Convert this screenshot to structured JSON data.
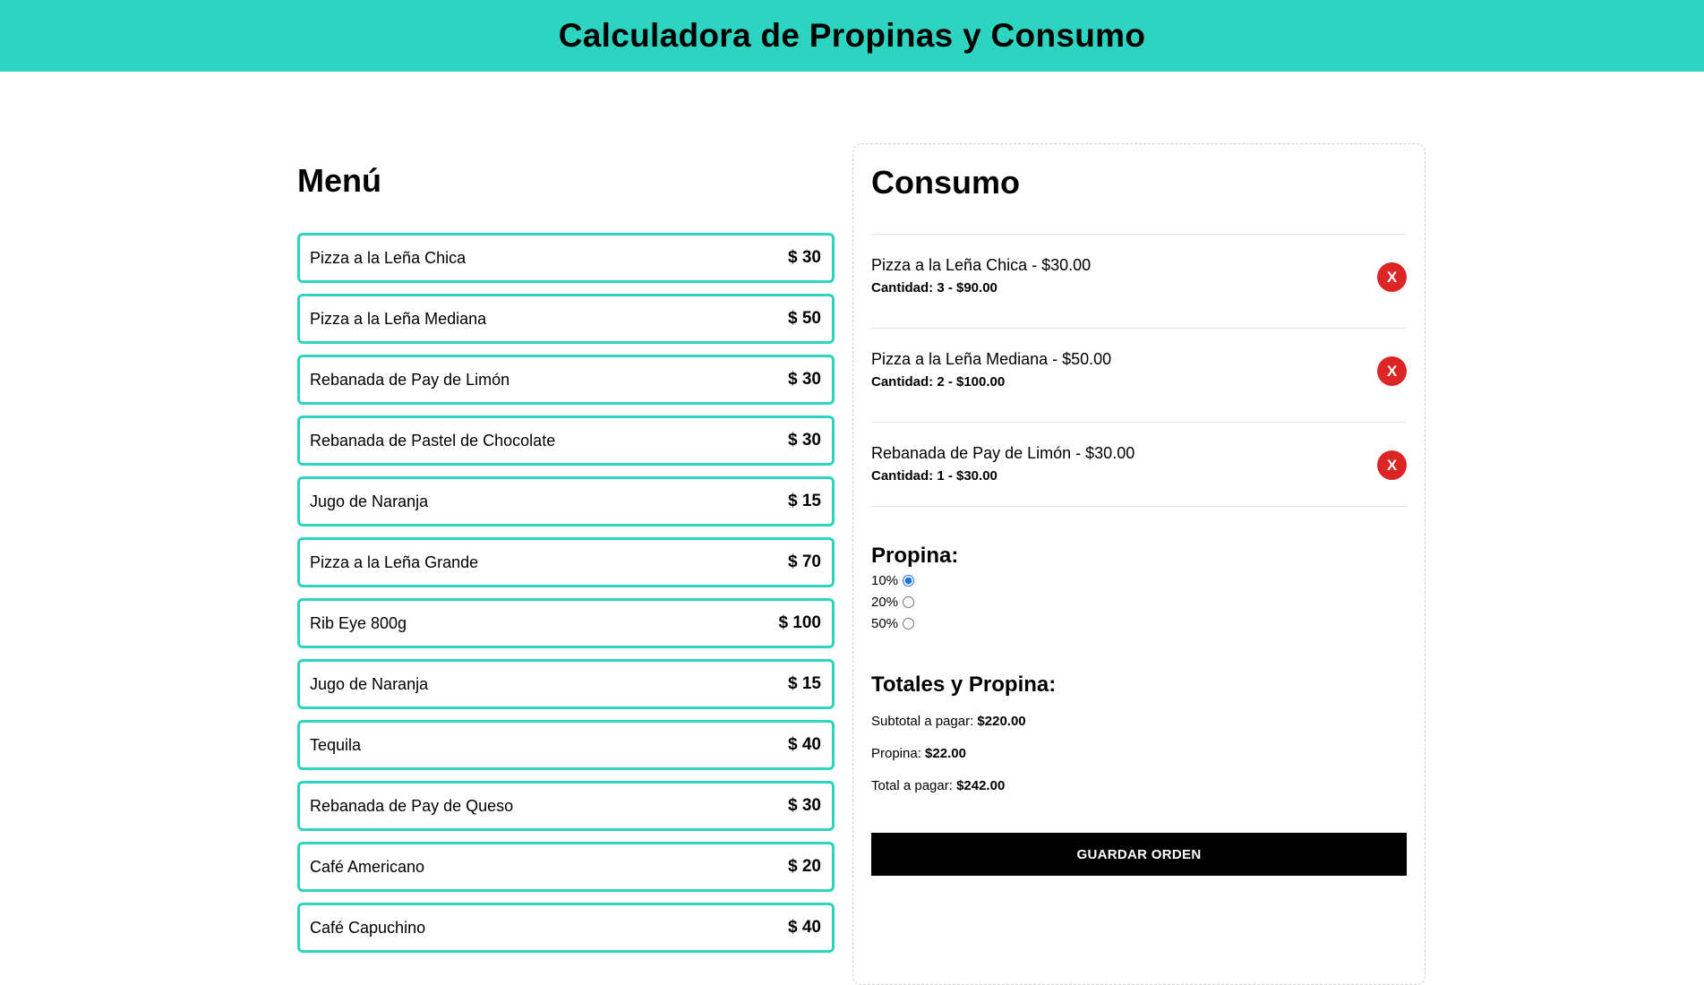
{
  "header": {
    "title": "Calculadora de Propinas y Consumo"
  },
  "menu": {
    "title": "Menú",
    "items": [
      {
        "name": "Pizza a la Leña Chica",
        "price": "$ 30"
      },
      {
        "name": "Pizza a la Leña Mediana",
        "price": "$ 50"
      },
      {
        "name": "Rebanada de Pay de Limón",
        "price": "$ 30"
      },
      {
        "name": "Rebanada de Pastel de Chocolate",
        "price": "$ 30"
      },
      {
        "name": "Jugo de Naranja",
        "price": "$ 15"
      },
      {
        "name": "Pizza a la Leña Grande",
        "price": "$ 70"
      },
      {
        "name": "Rib Eye 800g",
        "price": "$ 100"
      },
      {
        "name": "Jugo de Naranja",
        "price": "$ 15"
      },
      {
        "name": "Tequila",
        "price": "$ 40"
      },
      {
        "name": "Rebanada de Pay de Queso",
        "price": "$ 30"
      },
      {
        "name": "Café Americano",
        "price": "$ 20"
      },
      {
        "name": "Café Capuchino",
        "price": "$ 40"
      }
    ]
  },
  "consumo": {
    "title": "Consumo",
    "items": [
      {
        "label": "Pizza a la Leña Chica - $30.00",
        "qty": "Cantidad: 3 - $90.00",
        "delete_label": "X"
      },
      {
        "label": "Pizza a la Leña Mediana - $50.00",
        "qty": "Cantidad: 2 - $100.00",
        "delete_label": "X"
      },
      {
        "label": "Rebanada de Pay de Limón - $30.00",
        "qty": "Cantidad: 1 - $30.00",
        "delete_label": "X"
      }
    ]
  },
  "tip": {
    "title": "Propina:",
    "options": [
      {
        "label": "10%",
        "checked": true
      },
      {
        "label": "20%",
        "checked": false
      },
      {
        "label": "50%",
        "checked": false
      }
    ]
  },
  "totals": {
    "title": "Totales y Propina:",
    "subtotal_label": "Subtotal a pagar:",
    "subtotal_value": "$220.00",
    "tip_label": "Propina:",
    "tip_value": "$22.00",
    "total_label": "Total a pagar:",
    "total_value": "$242.00"
  },
  "save_button": "GUARDAR ORDEN",
  "colors": {
    "accent": "#2dd4bf",
    "delete": "#dc2626",
    "button": "#000000"
  }
}
